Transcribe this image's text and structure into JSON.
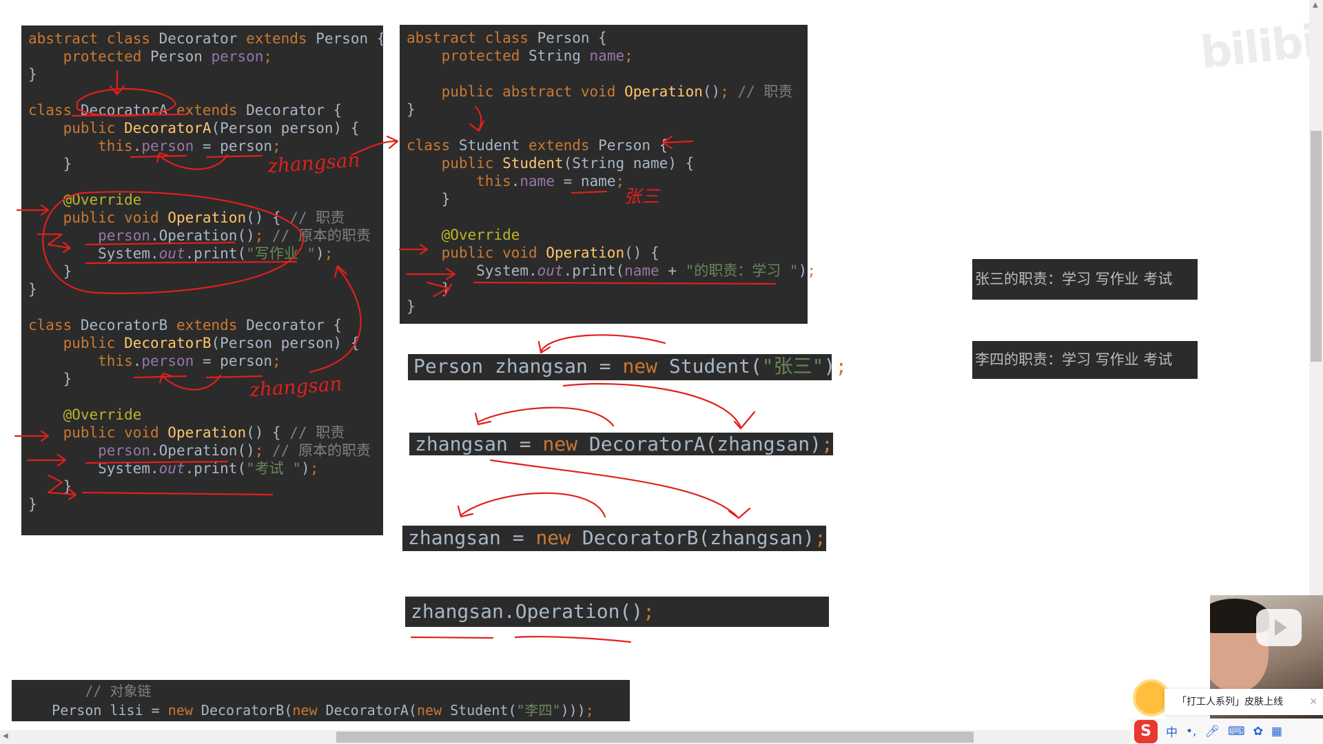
{
  "left_code": [
    [
      [
        "k",
        "abstract class "
      ],
      [
        "",
        "Decorator "
      ],
      [
        "k",
        "extends "
      ],
      [
        "",
        "Person {"
      ]
    ],
    [
      [
        "",
        "    "
      ],
      [
        "k",
        "protected "
      ],
      [
        "",
        "Person "
      ],
      [
        "fld",
        "person"
      ],
      [
        "k",
        ";"
      ]
    ],
    [
      [
        "",
        "}"
      ]
    ],
    [
      [
        "",
        ""
      ]
    ],
    [
      [
        "k",
        "class "
      ],
      [
        "",
        "DecoratorA "
      ],
      [
        "k",
        "extends "
      ],
      [
        "",
        "Decorator {"
      ]
    ],
    [
      [
        "",
        "    "
      ],
      [
        "k",
        "public "
      ],
      [
        "f",
        "DecoratorA"
      ],
      [
        "",
        "(Person person) {"
      ]
    ],
    [
      [
        "",
        "        "
      ],
      [
        "k",
        "this"
      ],
      [
        "",
        "."
      ],
      [
        "fld",
        "person"
      ],
      [
        "",
        " = person"
      ],
      [
        "k",
        ";"
      ]
    ],
    [
      [
        "",
        "    }"
      ]
    ],
    [
      [
        "",
        ""
      ]
    ],
    [
      [
        "",
        "    "
      ],
      [
        "a",
        "@Override"
      ]
    ],
    [
      [
        "",
        "    "
      ],
      [
        "k",
        "public void "
      ],
      [
        "f",
        "Operation"
      ],
      [
        "",
        "() { "
      ],
      [
        "c",
        "// 职责"
      ]
    ],
    [
      [
        "",
        "        "
      ],
      [
        "fld",
        "person"
      ],
      [
        "",
        ".Operation()"
      ],
      [
        "k",
        "; "
      ],
      [
        "c",
        "// 原本的职责"
      ]
    ],
    [
      [
        "",
        "        System."
      ],
      [
        "fi",
        "out"
      ],
      [
        "",
        ".print("
      ],
      [
        "s",
        "\"写作业 \""
      ],
      [
        "",
        ")"
      ],
      [
        "k",
        ";"
      ]
    ],
    [
      [
        "",
        "    }"
      ]
    ],
    [
      [
        "",
        "}"
      ]
    ],
    [
      [
        "",
        ""
      ]
    ],
    [
      [
        "k",
        "class "
      ],
      [
        "",
        "DecoratorB "
      ],
      [
        "k",
        "extends "
      ],
      [
        "",
        "Decorator {"
      ]
    ],
    [
      [
        "",
        "    "
      ],
      [
        "k",
        "public "
      ],
      [
        "f",
        "DecoratorB"
      ],
      [
        "",
        "(Person person) {"
      ]
    ],
    [
      [
        "",
        "        "
      ],
      [
        "k",
        "this"
      ],
      [
        "",
        "."
      ],
      [
        "fld",
        "person"
      ],
      [
        "",
        " = person"
      ],
      [
        "k",
        ";"
      ]
    ],
    [
      [
        "",
        "    }"
      ]
    ],
    [
      [
        "",
        ""
      ]
    ],
    [
      [
        "",
        "    "
      ],
      [
        "a",
        "@Override"
      ]
    ],
    [
      [
        "",
        "    "
      ],
      [
        "k",
        "public void "
      ],
      [
        "f",
        "Operation"
      ],
      [
        "",
        "() { "
      ],
      [
        "c",
        "// 职责"
      ]
    ],
    [
      [
        "",
        "        "
      ],
      [
        "fld",
        "person"
      ],
      [
        "",
        ".Operation()"
      ],
      [
        "k",
        "; "
      ],
      [
        "c",
        "// 原本的职责"
      ]
    ],
    [
      [
        "",
        "        System."
      ],
      [
        "fi",
        "out"
      ],
      [
        "",
        ".print("
      ],
      [
        "s",
        "\"考试 \""
      ],
      [
        "",
        ")"
      ],
      [
        "k",
        ";"
      ]
    ],
    [
      [
        "",
        "    }"
      ]
    ],
    [
      [
        "",
        "}"
      ]
    ]
  ],
  "right_code": [
    [
      [
        "k",
        "abstract class "
      ],
      [
        "",
        "Person {"
      ]
    ],
    [
      [
        "",
        "    "
      ],
      [
        "k",
        "protected "
      ],
      [
        "",
        "String "
      ],
      [
        "fld",
        "name"
      ],
      [
        "k",
        ";"
      ]
    ],
    [
      [
        "",
        ""
      ]
    ],
    [
      [
        "",
        "    "
      ],
      [
        "k",
        "public abstract void "
      ],
      [
        "f",
        "Operation"
      ],
      [
        "",
        "()"
      ],
      [
        "k",
        "; "
      ],
      [
        "c",
        "// 职责"
      ]
    ],
    [
      [
        "",
        "}"
      ]
    ],
    [
      [
        "",
        ""
      ]
    ],
    [
      [
        "k",
        "class "
      ],
      [
        "",
        "Student "
      ],
      [
        "k",
        "extends "
      ],
      [
        "",
        "Person {"
      ]
    ],
    [
      [
        "",
        "    "
      ],
      [
        "k",
        "public "
      ],
      [
        "f",
        "Student"
      ],
      [
        "",
        "(String name) {"
      ]
    ],
    [
      [
        "",
        "        "
      ],
      [
        "k",
        "this"
      ],
      [
        "",
        "."
      ],
      [
        "fld",
        "name"
      ],
      [
        "",
        " = name"
      ],
      [
        "k",
        ";"
      ]
    ],
    [
      [
        "",
        "    }"
      ]
    ],
    [
      [
        "",
        ""
      ]
    ],
    [
      [
        "",
        "    "
      ],
      [
        "a",
        "@Override"
      ]
    ],
    [
      [
        "",
        "    "
      ],
      [
        "k",
        "public void "
      ],
      [
        "f",
        "Operation"
      ],
      [
        "",
        "() {"
      ]
    ],
    [
      [
        "",
        "        System."
      ],
      [
        "fi",
        "out"
      ],
      [
        "",
        ".print("
      ],
      [
        "fld",
        "name"
      ],
      [
        "",
        " + "
      ],
      [
        "s",
        "\"的职责：学习 \""
      ],
      [
        "",
        ")"
      ],
      [
        "k",
        ";"
      ]
    ],
    [
      [
        "",
        "    }"
      ]
    ],
    [
      [
        "",
        "}"
      ]
    ]
  ],
  "statement1": [
    [
      "",
      "Person zhangsan = "
    ],
    [
      "k",
      "new "
    ],
    [
      "",
      "Student("
    ],
    [
      "s",
      "\"张三\""
    ],
    [
      "",
      ")"
    ],
    [
      "k",
      ";"
    ]
  ],
  "statement2": [
    [
      "",
      "zhangsan = "
    ],
    [
      "k",
      "new "
    ],
    [
      "",
      "DecoratorA(zhangsan)"
    ],
    [
      "k",
      ";"
    ]
  ],
  "statement3": [
    [
      "",
      "zhangsan = "
    ],
    [
      "k",
      "new "
    ],
    [
      "",
      "DecoratorB(zhangsan)"
    ],
    [
      "k",
      ";"
    ]
  ],
  "statement4": [
    [
      "",
      "zhangsan.Operation()"
    ],
    [
      "k",
      ";"
    ]
  ],
  "chain_code": [
    [
      [
        "",
        "        "
      ],
      [
        "c",
        "// 对象链"
      ]
    ],
    [
      [
        "",
        "    Person lisi = "
      ],
      [
        "k",
        "new "
      ],
      [
        "",
        "DecoratorB("
      ],
      [
        "k",
        "new "
      ],
      [
        "",
        "DecoratorA("
      ],
      [
        "k",
        "new "
      ],
      [
        "",
        "Student("
      ],
      [
        "s",
        "\"李四\""
      ],
      [
        "",
        ")))"
      ],
      [
        "k",
        ";"
      ]
    ]
  ],
  "output1": "张三的职责：学习 写作业 考试",
  "output2": "李四的职责：学习 写作业 考试",
  "annotations": {
    "zhangsan_1": "zhangsan",
    "zhangsan_2": "zhangsan",
    "zhangsan_cn": "张三"
  },
  "watermark": "bilibili",
  "toast_text": "「打工人系列」皮肤上线",
  "ime": {
    "logo": "S",
    "lang": "中",
    "punct": "•,"
  },
  "colors": {
    "ink": "#e0201c",
    "code_bg": "#2b2b2b"
  }
}
